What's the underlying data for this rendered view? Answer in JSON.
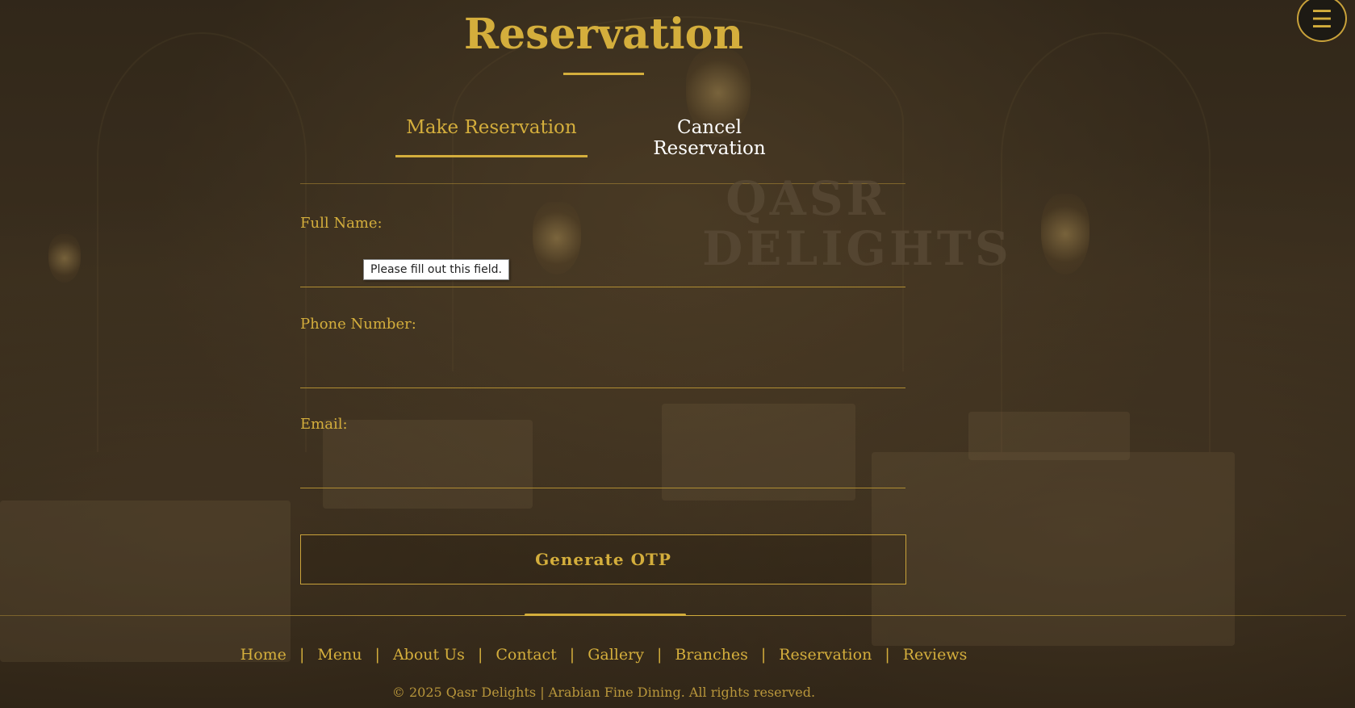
{
  "header": {
    "title": "Reservation",
    "menu_icon": "☰"
  },
  "tabs": [
    {
      "label": "Make Reservation",
      "active": true
    },
    {
      "label": "Cancel Reservation",
      "active": false
    }
  ],
  "watermark": {
    "line1": "QASR",
    "line2": "DELIGHTS"
  },
  "form": {
    "full_name": {
      "label": "Full Name:",
      "value": ""
    },
    "phone": {
      "label": "Phone Number:",
      "value": ""
    },
    "email": {
      "label": "Email:",
      "value": ""
    },
    "validation_tooltip": "Please fill out this field.",
    "submit_label": "Generate OTP"
  },
  "footer": {
    "links": [
      "Home",
      "Menu",
      "About Us",
      "Contact",
      "Gallery",
      "Branches",
      "Reservation",
      "Reviews"
    ],
    "separator": "|",
    "copyright": "© 2025 Qasr Delights | Arabian Fine Dining. All rights reserved."
  },
  "colors": {
    "accent": "#d4ae3c",
    "background": "#3a2e1f",
    "text_light": "#ffffff"
  }
}
